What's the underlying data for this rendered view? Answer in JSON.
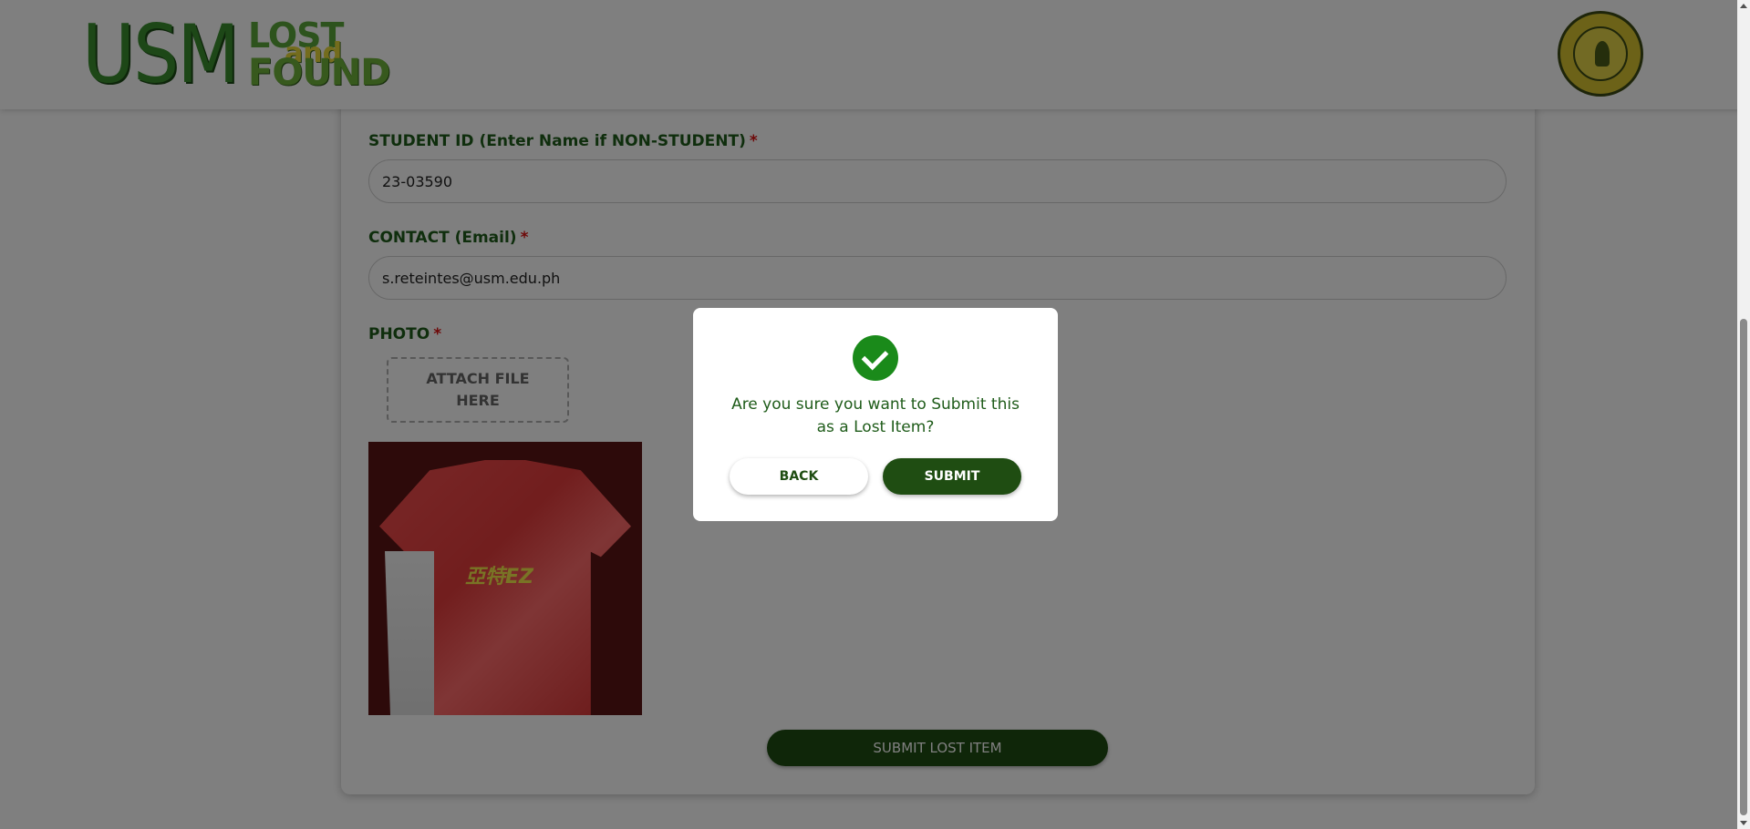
{
  "header": {
    "logo": {
      "usm": "USM",
      "lost": "LOST",
      "and": "and",
      "found": "FOUND"
    },
    "seal_icon": "university-seal-icon"
  },
  "form": {
    "student_id": {
      "label": "STUDENT ID (Enter Name if NON-STUDENT)",
      "required_mark": "*",
      "value": "23-03590"
    },
    "contact": {
      "label": "CONTACT (Email)",
      "required_mark": "*",
      "value": "s.reteintes@usm.edu.ph"
    },
    "photo": {
      "label": "PHOTO",
      "required_mark": "*",
      "attach_line1": "ATTACH FILE",
      "attach_line2": "HERE",
      "preview_icon": "red-shirt-photo",
      "preview_brand_text": "亞特EZ"
    },
    "submit_label": "SUBMIT LOST ITEM"
  },
  "modal": {
    "icon": "check-circle-icon",
    "message": "Are you sure you want to Submit this as a Lost Item?",
    "back_label": "BACK",
    "submit_label": "SUBMIT"
  },
  "colors": {
    "primary_green": "#1f4d12",
    "label_green": "#1f5c1a",
    "success_green": "#1a8a1a",
    "required_red": "#dd1111"
  }
}
